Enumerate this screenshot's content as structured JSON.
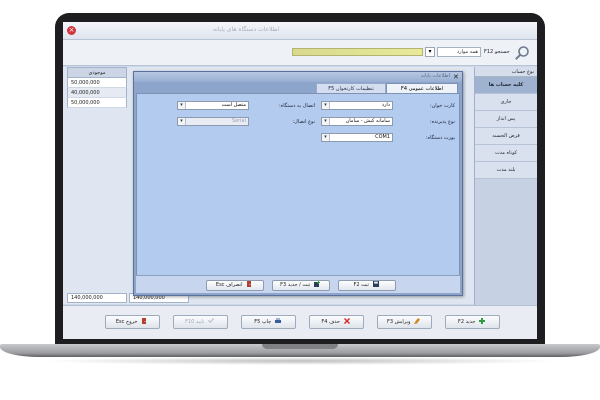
{
  "app": {
    "title": "اطلاعات دستگاه های پایانه",
    "close_glyph": "×"
  },
  "toolbar": {
    "search_label": "جستجو F12",
    "combo_value": "همه موارد",
    "dropdown_glyph": "▾"
  },
  "sidebar": {
    "header": "نوع حساب",
    "items": [
      {
        "label": "کلیه حساب ها",
        "active": true
      },
      {
        "label": "جاری",
        "active": false
      },
      {
        "label": "پس انداز",
        "active": false
      },
      {
        "label": "قرض الحسنه",
        "active": false
      },
      {
        "label": "کوتاه مدت",
        "active": false
      },
      {
        "label": "بلند مدت",
        "active": false
      }
    ]
  },
  "grid": {
    "amount_header": "موجودی",
    "amounts": [
      "50,000,000",
      "40,000,000",
      "50,000,000"
    ],
    "totals": [
      "140,000,000",
      "140,000,000"
    ]
  },
  "bottom_buttons": [
    {
      "label": "جدید F2",
      "enabled": true,
      "color": "#2f9a3e"
    },
    {
      "label": "ویرایش F3",
      "enabled": true,
      "color": "#d08a1e"
    },
    {
      "label": "حذف F4",
      "enabled": true,
      "color": "#d12b2b"
    },
    {
      "label": "چاپ F5",
      "enabled": true,
      "color": "#3a5d9a"
    },
    {
      "label": "تایید F10",
      "enabled": false,
      "color": "#9da7b5"
    },
    {
      "label": "خروج Esc",
      "enabled": true,
      "color": "#b0412f"
    }
  ],
  "dialog": {
    "title": "اطلاعات پایانه",
    "close_glyph": "✕",
    "tabs": {
      "general": "اطلاعات عمومی F4",
      "card": "تنظیمات کارتخوان F5"
    },
    "fields": {
      "card_reader_label": "کارت خوان:",
      "card_reader_value": "دارد",
      "device_type_label": "نوع پذیرنده:",
      "device_type_value": "سامانه کیش - سامان",
      "port_label": "پورت دستگاه:",
      "port_value": "COM1",
      "connect_label": "اتصال به دستگاه:",
      "connect_value": "متصل است",
      "conn_type_label": "نوع اتصال:",
      "conn_type_value": "Serial",
      "arrow_glyph": "▾"
    },
    "buttons": {
      "save": "ثبت F2",
      "save_new": "ثبت / جدید F3",
      "cancel": "انصراف Esc"
    }
  }
}
